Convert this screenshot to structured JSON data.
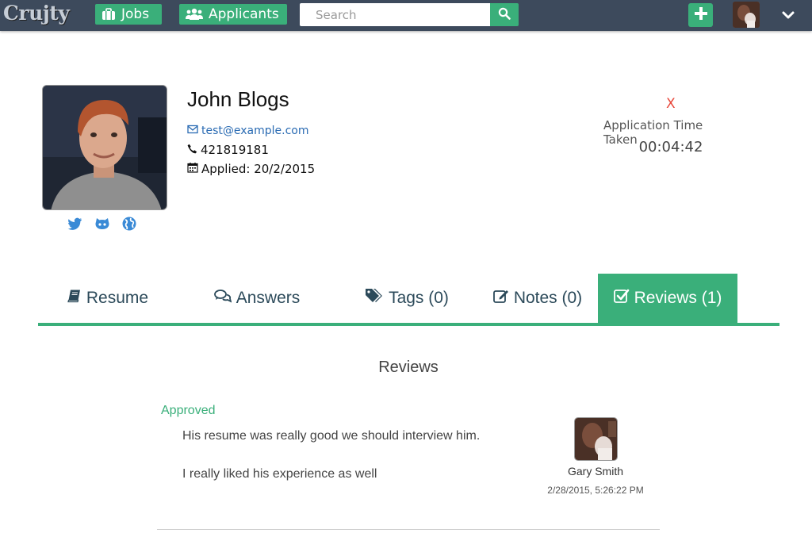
{
  "navbar": {
    "brand": "Crujty",
    "jobs_label": "Jobs",
    "applicants_label": "Applicants",
    "search_placeholder": "Search",
    "search_value": "",
    "icons": {
      "jobs": "briefcase-icon",
      "applicants": "users-icon",
      "search": "search-icon",
      "add": "plus-icon",
      "menu": "chevron-down-icon"
    }
  },
  "applicant": {
    "name": "John Blogs",
    "email": "test@example.com",
    "phone": "421819181",
    "applied": "Applied: 20/2/2015",
    "social": [
      "twitter-icon",
      "github-icon",
      "globe-icon"
    ]
  },
  "timer": {
    "close_label": "X",
    "label": "Application Time Taken",
    "value": "00:04:42"
  },
  "tabs": [
    {
      "label": "Resume",
      "icon": "book-icon",
      "active": false
    },
    {
      "label": "Answers",
      "icon": "comments-icon",
      "active": false
    },
    {
      "label": "Tags (0)",
      "icon": "tags-icon",
      "active": false
    },
    {
      "label": "Notes (0)",
      "icon": "edit-icon",
      "active": false
    },
    {
      "label": "Reviews (1)",
      "icon": "check-square-icon",
      "active": true
    }
  ],
  "reviews": {
    "title": "Reviews",
    "items": [
      {
        "status": "Approved",
        "lines": [
          "His resume was really good we should interview him.",
          "I really liked his experience as well"
        ],
        "reviewer": "Gary Smith",
        "date": "2/28/2015, 5:26:22 PM"
      }
    ]
  },
  "colors": {
    "navbar": "#3d4a5c",
    "accent": "#3aaf7a",
    "link": "#2a6bb3",
    "close": "#e8473a"
  }
}
